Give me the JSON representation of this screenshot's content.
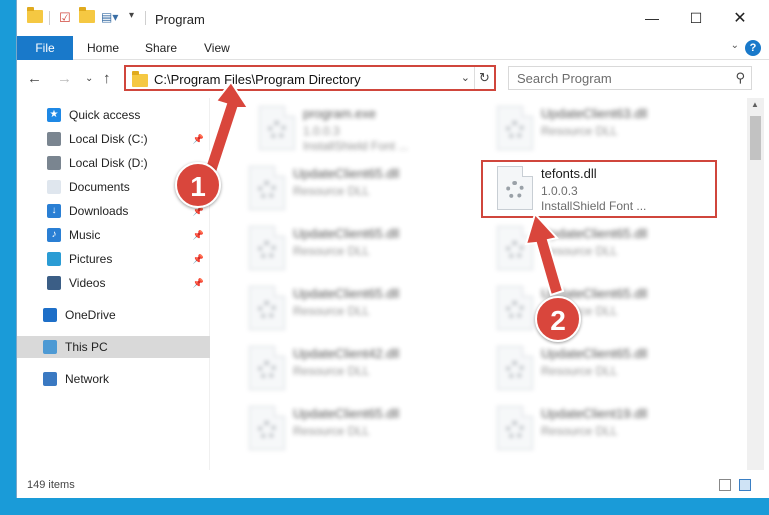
{
  "window": {
    "title": "Program"
  },
  "ribbon": {
    "tabs": [
      "File",
      "Home",
      "Share",
      "View"
    ],
    "help": "?"
  },
  "navigation": {
    "address": "C:\\Program Files\\Program Directory",
    "search_placeholder": "Search Program"
  },
  "sidebar": {
    "items": [
      {
        "label": "Quick access",
        "icon": "star-icon",
        "pinned": false
      },
      {
        "label": "Local Disk (C:)",
        "icon": "drive-icon",
        "pinned": true
      },
      {
        "label": "Local Disk (D:)",
        "icon": "drive-icon",
        "pinned": false
      },
      {
        "label": "Documents",
        "icon": "documents-icon",
        "pinned": true
      },
      {
        "label": "Downloads",
        "icon": "download-icon",
        "pinned": true
      },
      {
        "label": "Music",
        "icon": "music-icon",
        "pinned": true
      },
      {
        "label": "Pictures",
        "icon": "pictures-icon",
        "pinned": true
      },
      {
        "label": "Videos",
        "icon": "videos-icon",
        "pinned": true
      },
      {
        "label": "OneDrive",
        "icon": "cloud-icon",
        "pinned": false
      },
      {
        "label": "This PC",
        "icon": "computer-icon",
        "pinned": false,
        "selected": true
      },
      {
        "label": "Network",
        "icon": "network-icon",
        "pinned": false
      }
    ]
  },
  "files": [
    {
      "name": "program.exe",
      "version": "1.0.0.3",
      "desc": "InstallShield Font ...",
      "blurred": true
    },
    {
      "name": "UpdateClient63.dll",
      "version": "Resource DLL",
      "desc": "",
      "blurred": true
    },
    {
      "name": "UpdateClient65.dll",
      "version": "Resource DLL",
      "desc": "",
      "blurred": true
    },
    {
      "name": "tefonts.dll",
      "version": "1.0.0.3",
      "desc": "InstallShield Font ...",
      "blurred": false
    },
    {
      "name": "UpdateClient65.dll",
      "version": "Resource DLL",
      "desc": "",
      "blurred": true
    },
    {
      "name": "UpdateClient65.dll",
      "version": "Resource DLL",
      "desc": "",
      "blurred": true
    },
    {
      "name": "UpdateClient65.dll",
      "version": "Resource DLL",
      "desc": "",
      "blurred": true
    },
    {
      "name": "UpdateClient65.dll",
      "version": "Resource DLL",
      "desc": "",
      "blurred": true
    },
    {
      "name": "UpdateClient42.dll",
      "version": "Resource DLL",
      "desc": "",
      "blurred": true
    },
    {
      "name": "UpdateClient65.dll",
      "version": "Resource DLL",
      "desc": "",
      "blurred": true
    },
    {
      "name": "UpdateClient65.dll",
      "version": "Resource DLL",
      "desc": "",
      "blurred": true
    },
    {
      "name": "UpdateClient19.dll",
      "version": "Resource DLL",
      "desc": "",
      "blurred": true
    }
  ],
  "status": {
    "count": "149 items"
  },
  "annotations": {
    "step1": "1",
    "step2": "2",
    "color": "#d9463c"
  }
}
